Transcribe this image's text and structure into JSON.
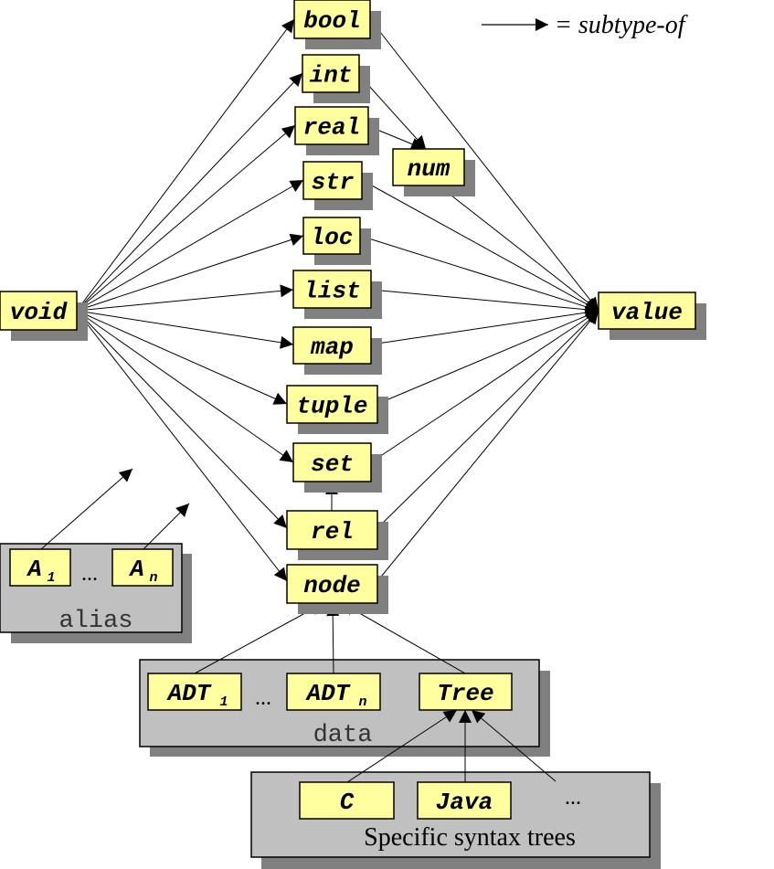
{
  "legend": {
    "label": "= subtype-of"
  },
  "types": {
    "void": "void",
    "value": "value",
    "bool": "bool",
    "int": "int",
    "real": "real",
    "num": "num",
    "str": "str",
    "loc": "loc",
    "list": "list",
    "map": "map",
    "tuple": "tuple",
    "set": "set",
    "rel": "rel",
    "node": "node"
  },
  "alias_group": {
    "label": "alias",
    "items": [
      {
        "base": "A",
        "sub": "1"
      },
      {
        "base": "A",
        "sub": "n"
      }
    ],
    "ellipsis": "..."
  },
  "data_group": {
    "label": "data",
    "items": [
      {
        "base": "ADT",
        "sub": "1"
      },
      {
        "base": "ADT",
        "sub": "n"
      }
    ],
    "tree": "Tree",
    "ellipsis": "..."
  },
  "syntax_group": {
    "label": "Specific syntax trees",
    "items": [
      "C",
      "Java"
    ],
    "ellipsis": "..."
  },
  "colors": {
    "node_fill": "#ffffa0",
    "shadow": "#808080",
    "group_fill": "#c0c0c0",
    "stroke": "#000000"
  }
}
